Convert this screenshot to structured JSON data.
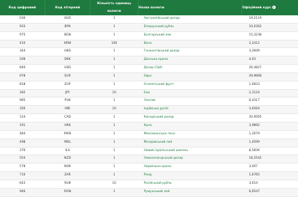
{
  "table": {
    "headers": {
      "digital": "Код цифровий",
      "letter": "Код літерний",
      "units": "Кількість одиниць валюти",
      "name": "Назва валюти",
      "rate": "Офіційний курс"
    },
    "rows": [
      {
        "digital": "036",
        "letter": "AUD",
        "units": "1",
        "name": "Австралійський долар",
        "rate": "19,2119"
      },
      {
        "digital": "933",
        "letter": "BYN",
        "units": "1",
        "name": "Білоруський рубль",
        "rate": "10,6362"
      },
      {
        "digital": "975",
        "letter": "BGN",
        "units": "1",
        "name": "Болгарський лев",
        "rate": "15,3238"
      },
      {
        "digital": "410",
        "letter": "KRW",
        "units": "100",
        "name": "Вона",
        "rate": "2,2412"
      },
      {
        "digital": "344",
        "letter": "HKD",
        "units": "1",
        "name": "Гонконгівський долар",
        "rate": "3,3949"
      },
      {
        "digital": "208",
        "letter": "DKK",
        "units": "1",
        "name": "Данська крона",
        "rate": "4,03"
      },
      {
        "digital": "840",
        "letter": "USD",
        "units": "1",
        "name": "Долар США",
        "rate": "26,4827"
      },
      {
        "digital": "978",
        "letter": "EUR",
        "units": "1",
        "name": "Євро",
        "rate": "29,9668"
      },
      {
        "digital": "818",
        "letter": "EGP",
        "units": "1",
        "name": "Єгипетський фунт",
        "rate": "1,6833"
      },
      {
        "digital": "392",
        "letter": "JPY",
        "units": "10",
        "name": "Єна",
        "rate": "2,3124"
      },
      {
        "digital": "985",
        "letter": "PLN",
        "units": "1",
        "name": "Злотий",
        "rate": "6,4317"
      },
      {
        "digital": "356",
        "letter": "INR",
        "units": "10",
        "name": "Індійська рупія",
        "rate": "3,6564"
      },
      {
        "digital": "124",
        "letter": "CAD",
        "units": "1",
        "name": "Канадський долар",
        "rate": "20,9565"
      },
      {
        "digital": "191",
        "letter": "HRK",
        "units": "1",
        "name": "Куна",
        "rate": "3,9892"
      },
      {
        "digital": "484",
        "letter": "MXN",
        "units": "1",
        "name": "Мексиканське песо",
        "rate": "1,2679"
      },
      {
        "digital": "498",
        "letter": "MDL",
        "units": "1",
        "name": "Молдовський лей",
        "rate": "1,4599"
      },
      {
        "digital": "376",
        "letter": "ILS",
        "units": "1",
        "name": "Новий ізраїльський шекель",
        "rate": "8,5836"
      },
      {
        "digital": "554",
        "letter": "NZD",
        "units": "1",
        "name": "Новозеландський долар",
        "rate": "18,2542"
      },
      {
        "digital": "578",
        "letter": "NOK",
        "units": "1",
        "name": "Норвезька крона",
        "rate": "3,007"
      },
      {
        "digital": "710",
        "letter": "ZAR",
        "units": "1",
        "name": "Ранд",
        "rate": "1,6765"
      },
      {
        "digital": "643",
        "letter": "RUB",
        "units": "10",
        "name": "Російський рубль",
        "rate": "3,614"
      },
      {
        "digital": "946",
        "letter": "RON",
        "units": "1",
        "name": "Румунський лей",
        "rate": "6,6547"
      }
    ]
  }
}
